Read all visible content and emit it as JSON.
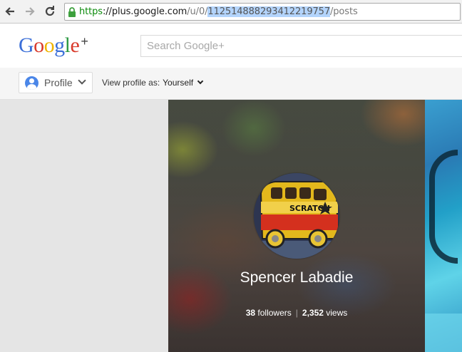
{
  "browser": {
    "url_scheme": "https",
    "url_sep": "://",
    "url_host": "plus.google.com",
    "url_path_prefix": "/u/0/",
    "url_selected": "112514888293412219757",
    "url_path_suffix": "/posts"
  },
  "header": {
    "logo_letters": [
      "G",
      "o",
      "o",
      "g",
      "l",
      "e"
    ],
    "logo_colors": [
      "#3b6fd8",
      "#d93a2b",
      "#f0b400",
      "#3b6fd8",
      "#2e9a45",
      "#d93a2b"
    ],
    "logo_plus": "+",
    "search_placeholder": "Search Google+"
  },
  "subbar": {
    "profile_label": "Profile",
    "view_as_label": "View profile as:",
    "view_as_value": "Yourself"
  },
  "profile": {
    "name": "Spencer Labadie",
    "followers_count": "38",
    "followers_label": "followers",
    "separator": "|",
    "views_count": "2,352",
    "views_label": "views",
    "photo_text": "SCRATCH"
  }
}
